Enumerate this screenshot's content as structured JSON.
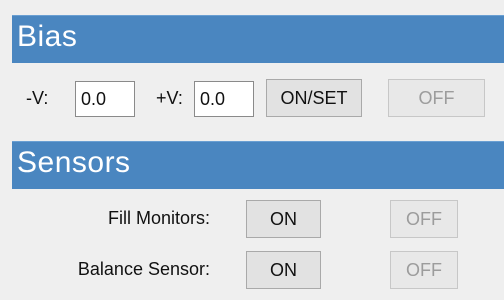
{
  "bias": {
    "title": "Bias",
    "neg_label": "-V:",
    "neg_value": "0.0",
    "pos_label": "+V:",
    "pos_value": "0.0",
    "on_set_label": "ON/SET",
    "off_label": "OFF"
  },
  "sensors": {
    "title": "Sensors",
    "rows": [
      {
        "label": "Fill Monitors:",
        "on_label": "ON",
        "off_label": "OFF"
      },
      {
        "label": "Balance Sensor:",
        "on_label": "ON",
        "off_label": "OFF"
      }
    ]
  }
}
